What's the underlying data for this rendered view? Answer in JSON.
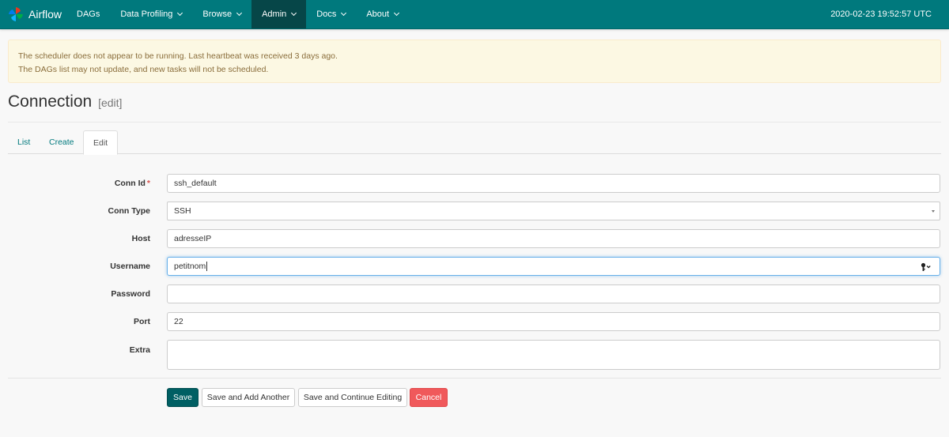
{
  "navbar": {
    "brand": "Airflow",
    "items": [
      {
        "label": "DAGs",
        "dropdown": false
      },
      {
        "label": "Data Profiling",
        "dropdown": true
      },
      {
        "label": "Browse",
        "dropdown": true
      },
      {
        "label": "Admin",
        "dropdown": true,
        "active": true
      },
      {
        "label": "Docs",
        "dropdown": true
      },
      {
        "label": "About",
        "dropdown": true
      }
    ],
    "clock": "2020-02-23 19:52:57 UTC"
  },
  "alert": {
    "line1": "The scheduler does not appear to be running. Last heartbeat was received 3 days ago.",
    "line2": "The DAGs list may not update, and new tasks will not be scheduled."
  },
  "page": {
    "title": "Connection",
    "subtitle": "[edit]"
  },
  "tabs": [
    "List",
    "Create",
    "Edit"
  ],
  "form": {
    "conn_id": {
      "label": "Conn Id",
      "required_mark": "*",
      "value": "ssh_default"
    },
    "conn_type": {
      "label": "Conn Type",
      "value": "SSH"
    },
    "host": {
      "label": "Host",
      "value": "adresseIP"
    },
    "username": {
      "label": "Username",
      "value": "petitnom"
    },
    "password": {
      "label": "Password",
      "value": ""
    },
    "port": {
      "label": "Port",
      "value": "22"
    },
    "extra": {
      "label": "Extra",
      "value": ""
    }
  },
  "buttons": {
    "save": "Save",
    "save_add": "Save and Add Another",
    "save_continue": "Save and Continue Editing",
    "cancel": "Cancel"
  },
  "colors": {
    "navbar": "#00797d",
    "nav_active": "#064648",
    "alert_bg": "#fcf8e3",
    "alert_text": "#8a6d3b",
    "save_button": "#005f63",
    "cancel_button": "#f0595b"
  },
  "icons": {
    "brand": "airflow-pinwheel-icon",
    "dropdown": "caret-down-icon",
    "select": "select-caret-icon",
    "password_manager": "key-icon"
  }
}
